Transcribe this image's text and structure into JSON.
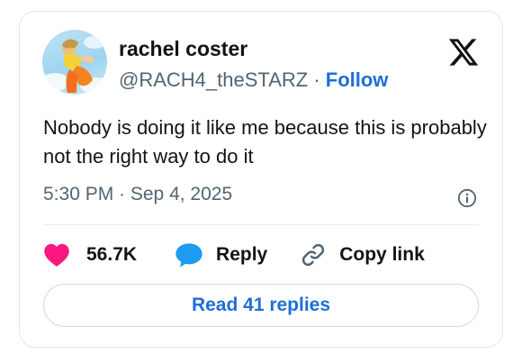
{
  "author": {
    "name": "rachel coster",
    "handle": "@RACH4_theSTARZ",
    "separator": " · ",
    "follow_label": "Follow"
  },
  "tweet": {
    "text": "Nobody is doing it like me because this is probably not the right way to do it",
    "timestamp": "5:30 PM · Sep 4, 2025"
  },
  "actions": {
    "like_count": "56.7K",
    "reply_label": "Reply",
    "copy_link_label": "Copy link"
  },
  "read_replies_label": "Read 41 replies",
  "colors": {
    "link_blue": "#1d6fd8",
    "like_pink": "#f91880",
    "reply_blue": "#1d9bf0",
    "muted_text": "#536471"
  },
  "icons": {
    "brand": "x-logo-icon",
    "info": "info-icon",
    "like": "heart-icon",
    "reply": "speech-bubble-icon",
    "copy": "link-icon"
  }
}
